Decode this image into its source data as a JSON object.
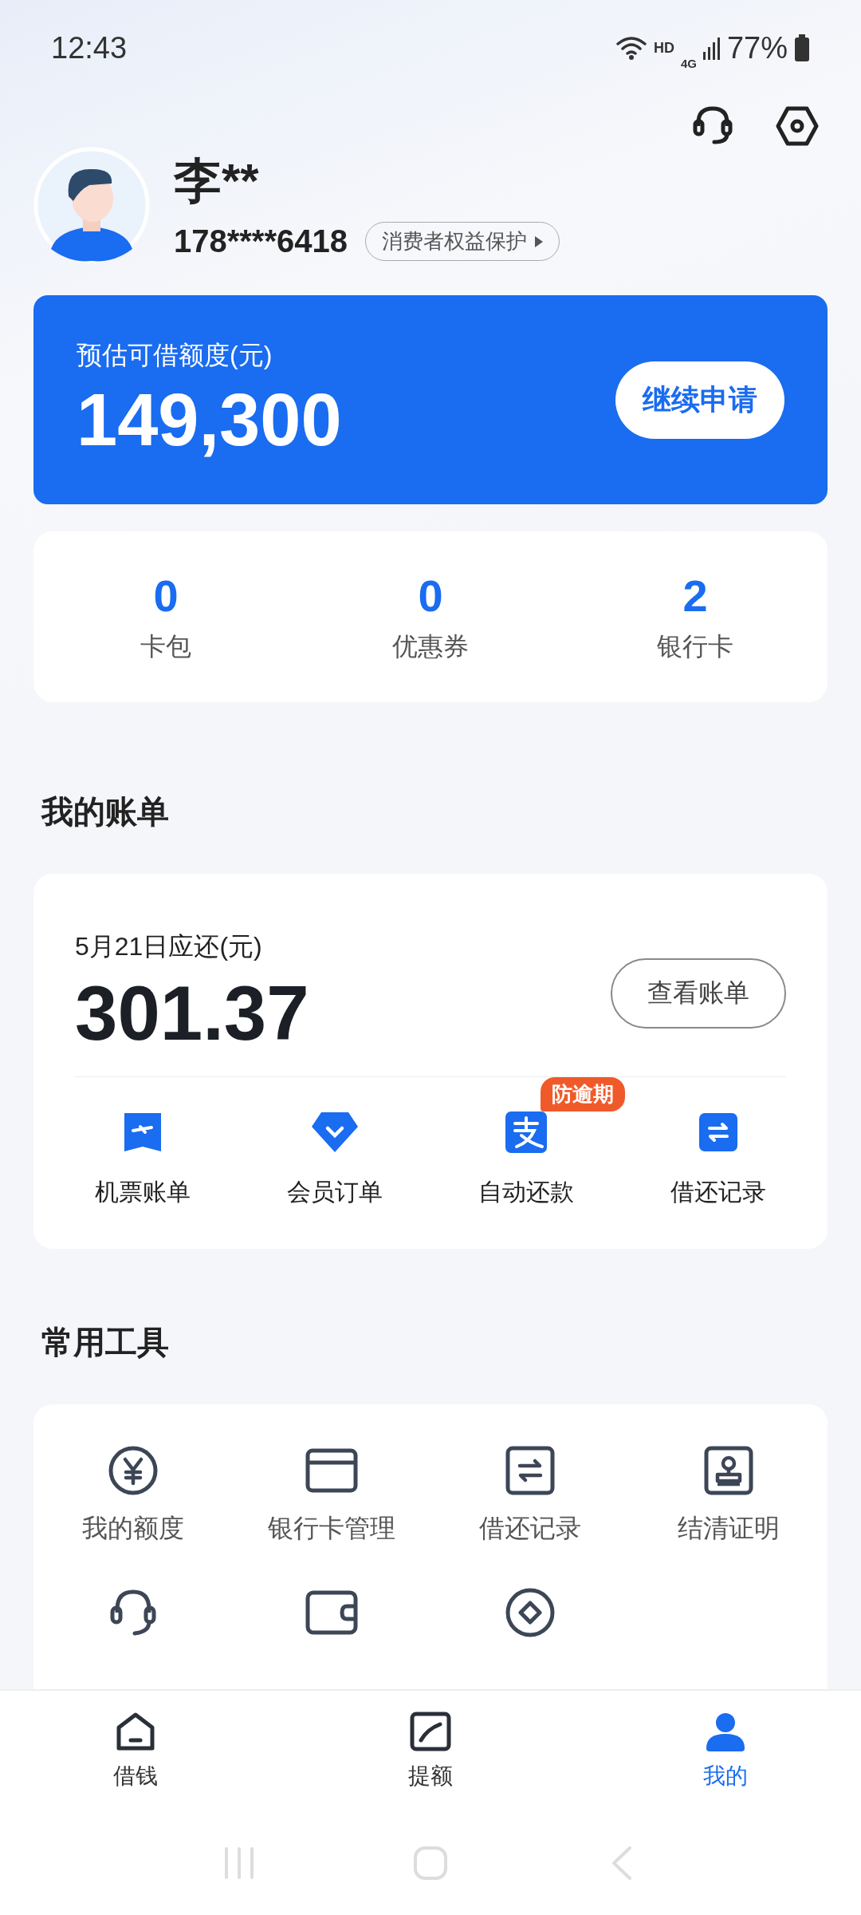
{
  "status_bar": {
    "time": "12:43",
    "network": "HD",
    "cell": "4G",
    "battery": "77%"
  },
  "profile": {
    "name": "李**",
    "phone": "178****6418",
    "protection_link": "消费者权益保护"
  },
  "credit_card": {
    "label": "预估可借额度(元)",
    "amount": "149,300",
    "button": "继续申请"
  },
  "stats": [
    {
      "value": "0",
      "label": "卡包"
    },
    {
      "value": "0",
      "label": "优惠券"
    },
    {
      "value": "2",
      "label": "银行卡"
    }
  ],
  "bills": {
    "title": "我的账单",
    "due_label": "5月21日应还(元)",
    "amount": "301.37",
    "button": "查看账单",
    "shortcuts": [
      {
        "kind": "ticket",
        "label": "机票账单"
      },
      {
        "kind": "diamond",
        "label": "会员订单"
      },
      {
        "kind": "pay",
        "label": "自动还款",
        "badge": "防逾期"
      },
      {
        "kind": "transfer",
        "label": "借还记录"
      }
    ]
  },
  "tools": {
    "title": "常用工具",
    "items": [
      {
        "kind": "yen",
        "label": "我的额度"
      },
      {
        "kind": "card",
        "label": "银行卡管理"
      },
      {
        "kind": "transfer",
        "label": "借还记录"
      },
      {
        "kind": "certificate",
        "label": "结清证明"
      },
      {
        "kind": "headset"
      },
      {
        "kind": "wallet"
      },
      {
        "kind": "coin"
      }
    ]
  },
  "bottom_nav": [
    {
      "kind": "home",
      "label": "借钱",
      "selected": false
    },
    {
      "kind": "raise",
      "label": "提额",
      "selected": false
    },
    {
      "kind": "me",
      "label": "我的",
      "selected": true
    }
  ]
}
